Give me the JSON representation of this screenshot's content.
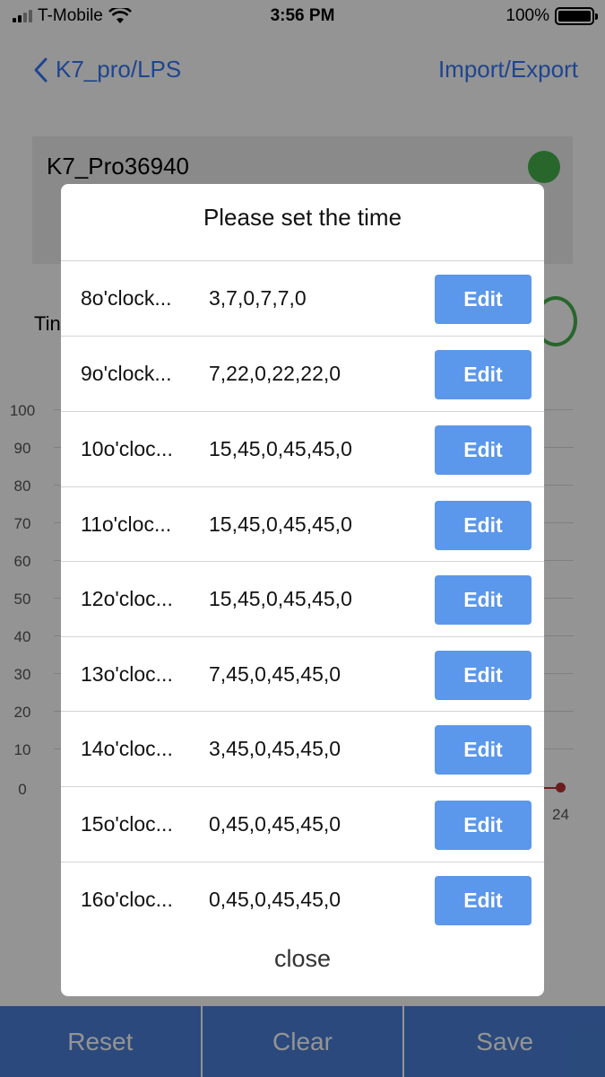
{
  "status_bar": {
    "carrier": "T-Mobile",
    "time": "3:56 PM",
    "battery": "100%"
  },
  "nav": {
    "back_label": "K7_pro/LPS",
    "action_label": "Import/Export"
  },
  "device": {
    "name": "K7_Pro36940",
    "status_color": "#46b04a"
  },
  "time_label": "Tin",
  "chart": {
    "y_ticks": [
      "100",
      "90",
      "80",
      "70",
      "60",
      "50",
      "40",
      "30",
      "20",
      "10",
      "0"
    ],
    "x_tick_visible": "24"
  },
  "bottom_bar": {
    "reset": "Reset",
    "clear": "Clear",
    "save": "Save"
  },
  "modal": {
    "title": "Please set the time",
    "edit_label": "Edit",
    "close_label": "close",
    "rows": [
      {
        "label": "8o'clock...",
        "values": "3,7,0,7,7,0"
      },
      {
        "label": "9o'clock...",
        "values": "7,22,0,22,22,0"
      },
      {
        "label": "10o'cloc...",
        "values": "15,45,0,45,45,0"
      },
      {
        "label": "11o'cloc...",
        "values": "15,45,0,45,45,0"
      },
      {
        "label": "12o'cloc...",
        "values": "15,45,0,45,45,0"
      },
      {
        "label": "13o'cloc...",
        "values": "7,45,0,45,45,0"
      },
      {
        "label": "14o'cloc...",
        "values": "3,45,0,45,45,0"
      },
      {
        "label": "15o'cloc...",
        "values": "0,45,0,45,45,0"
      },
      {
        "label": "16o'cloc...",
        "values": "0,45,0,45,45,0"
      }
    ]
  },
  "colors": {
    "accent": "#3478f6",
    "button": "#5b97ea",
    "bottom_bar": "#4a7fd6",
    "series": "#b83232"
  }
}
